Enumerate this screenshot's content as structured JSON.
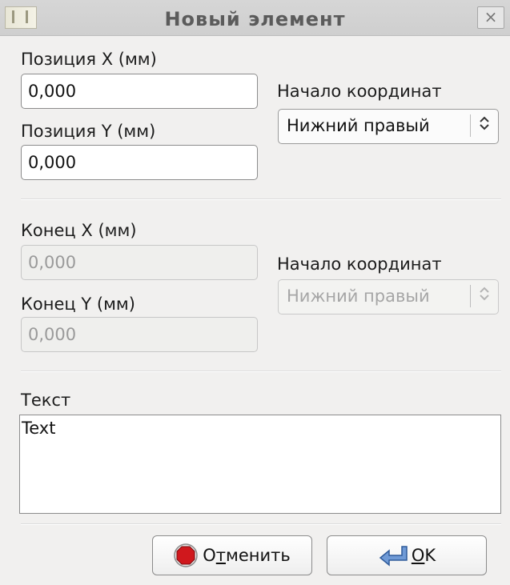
{
  "window": {
    "title": "Новый элемент",
    "close_glyph": "×"
  },
  "position": {
    "x_label": "Позиция X (мм)",
    "x_value": "0,000",
    "y_label": "Позиция Y (мм)",
    "y_value": "0,000",
    "origin_label": "Начало координат",
    "origin_value": "Нижний правый"
  },
  "end": {
    "x_label": "Конец X (мм)",
    "x_value": "0,000",
    "y_label": "Конец Y (мм)",
    "y_value": "0,000",
    "origin_label": "Начало координат",
    "origin_value": "Нижний правый"
  },
  "text_section": {
    "label": "Текст",
    "value": "Text"
  },
  "buttons": {
    "cancel_pre": "О",
    "cancel_mnemonic": "т",
    "cancel_post": "менить",
    "ok_mnemonic": "O",
    "ok_post": "K"
  },
  "icons": {
    "app": "app-icon",
    "close": "close-icon",
    "spin": "updown-chevron-icon",
    "cancel": "stop-icon",
    "ok": "enter-arrow-icon"
  },
  "colors": {
    "stop_red": "#d0181d",
    "ok_blue": "#4b7fc6"
  }
}
